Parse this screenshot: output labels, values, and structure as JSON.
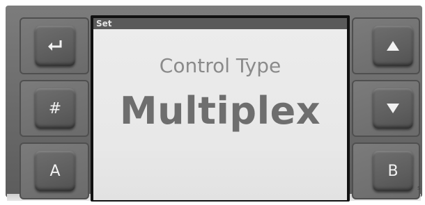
{
  "screen": {
    "header": "Set",
    "subtitle": "Control Type",
    "value": "Multiplex"
  },
  "left_keys": [
    {
      "icon": "enter-arrow-icon",
      "label": ""
    },
    {
      "icon": "",
      "label": "#"
    },
    {
      "icon": "",
      "label": "A"
    }
  ],
  "right_keys": [
    {
      "icon": "triangle-up-icon",
      "label": ""
    },
    {
      "icon": "triangle-down-icon",
      "label": ""
    },
    {
      "icon": "",
      "label": "B"
    }
  ],
  "edge_mark": "s",
  "colors": {
    "bezel": "#6a6a6a",
    "lcd": "#e8e8e8",
    "text_light": "#8a8a8a",
    "text_value": "#6e6e6e"
  }
}
